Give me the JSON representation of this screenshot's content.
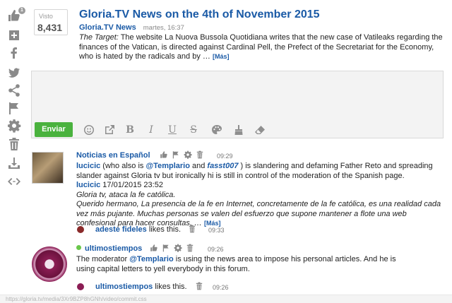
{
  "rail": {
    "badge": "1",
    "icons": [
      "thumbs-up-icon",
      "add-icon",
      "facebook-icon",
      "twitter-icon",
      "share-icon",
      "flag-icon",
      "gear-icon",
      "trash-icon",
      "download-icon",
      "embed-icon"
    ]
  },
  "views": {
    "label": "Visto",
    "count": "8,431"
  },
  "post": {
    "title": "Gloria.TV News on the 4th of November 2015",
    "source": "Gloria.TV News",
    "date": "martes, 16:37",
    "lead": "The Target:",
    "body": " The website La Nuova Bussola Quotidiana writes that the new case of Vatileaks regarding the finances of the Vatican, is directed against Cardinal Pell, the Prefect of the Secretariat for the Economy, who is hated by the radicals and by … ",
    "more": "[Más]"
  },
  "editor": {
    "send_label": "Enviar",
    "tools": [
      "smiley-icon",
      "external-link-icon",
      "bold-icon",
      "italic-icon",
      "underline-icon",
      "strikethrough-icon",
      "palette-icon",
      "brush-icon",
      "eraser-icon"
    ]
  },
  "comments": [
    {
      "author": "Noticias en Español",
      "time": "09:29",
      "line1_user": "lucicic",
      "line1_a": " (who also is ",
      "line1_m1": "@Templario",
      "line1_b": " and ",
      "line1_m2": "fasst007",
      "line1_c": " ) is slandering and defaming Father Reto and spreading slander against Gloria tv but ironically hi is still in control of the moderation of the Spanish page.",
      "quote_user": "lucicic",
      "quote_date": " 17/01/2015 23:52",
      "quote_title": "Gloria tv, ataca la fe católica.",
      "quote_body": "Querido hermano, La presencia de la fe en Internet, concretamente de la fe católica, es una realidad cada vez más pujante. Muchas personas se valen del esfuerzo que supone mantener a flote una web confesional para hacer consultas, … ",
      "more": "[Más]",
      "like_user": "adeste fideles",
      "like_text": " likes this.",
      "like_time": "09:33"
    },
    {
      "author": "ultimostiempos",
      "time": "09:26",
      "text_a": "The moderator ",
      "mention": "@Templario",
      "text_b": " is using the news area to impose his personal articles. And he is using capital letters to yell everybody in this forum.",
      "like_user": "ultimostiempos",
      "like_text": " likes this.",
      "like_time": "09:26"
    }
  ],
  "statusbar": "https://gloria.tv/media/3Xr9BZP8hGNh/video/commit.css"
}
